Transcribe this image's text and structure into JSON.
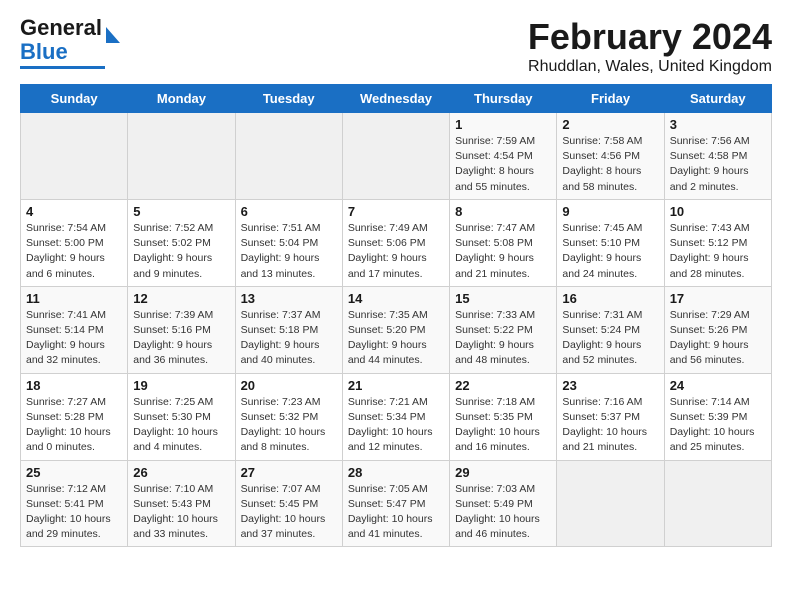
{
  "header": {
    "logo_general": "General",
    "logo_blue": "Blue",
    "main_title": "February 2024",
    "subtitle": "Rhuddlan, Wales, United Kingdom"
  },
  "weekdays": [
    "Sunday",
    "Monday",
    "Tuesday",
    "Wednesday",
    "Thursday",
    "Friday",
    "Saturday"
  ],
  "weeks": [
    [
      {
        "day": "",
        "info": ""
      },
      {
        "day": "",
        "info": ""
      },
      {
        "day": "",
        "info": ""
      },
      {
        "day": "",
        "info": ""
      },
      {
        "day": "1",
        "info": "Sunrise: 7:59 AM\nSunset: 4:54 PM\nDaylight: 8 hours\nand 55 minutes."
      },
      {
        "day": "2",
        "info": "Sunrise: 7:58 AM\nSunset: 4:56 PM\nDaylight: 8 hours\nand 58 minutes."
      },
      {
        "day": "3",
        "info": "Sunrise: 7:56 AM\nSunset: 4:58 PM\nDaylight: 9 hours\nand 2 minutes."
      }
    ],
    [
      {
        "day": "4",
        "info": "Sunrise: 7:54 AM\nSunset: 5:00 PM\nDaylight: 9 hours\nand 6 minutes."
      },
      {
        "day": "5",
        "info": "Sunrise: 7:52 AM\nSunset: 5:02 PM\nDaylight: 9 hours\nand 9 minutes."
      },
      {
        "day": "6",
        "info": "Sunrise: 7:51 AM\nSunset: 5:04 PM\nDaylight: 9 hours\nand 13 minutes."
      },
      {
        "day": "7",
        "info": "Sunrise: 7:49 AM\nSunset: 5:06 PM\nDaylight: 9 hours\nand 17 minutes."
      },
      {
        "day": "8",
        "info": "Sunrise: 7:47 AM\nSunset: 5:08 PM\nDaylight: 9 hours\nand 21 minutes."
      },
      {
        "day": "9",
        "info": "Sunrise: 7:45 AM\nSunset: 5:10 PM\nDaylight: 9 hours\nand 24 minutes."
      },
      {
        "day": "10",
        "info": "Sunrise: 7:43 AM\nSunset: 5:12 PM\nDaylight: 9 hours\nand 28 minutes."
      }
    ],
    [
      {
        "day": "11",
        "info": "Sunrise: 7:41 AM\nSunset: 5:14 PM\nDaylight: 9 hours\nand 32 minutes."
      },
      {
        "day": "12",
        "info": "Sunrise: 7:39 AM\nSunset: 5:16 PM\nDaylight: 9 hours\nand 36 minutes."
      },
      {
        "day": "13",
        "info": "Sunrise: 7:37 AM\nSunset: 5:18 PM\nDaylight: 9 hours\nand 40 minutes."
      },
      {
        "day": "14",
        "info": "Sunrise: 7:35 AM\nSunset: 5:20 PM\nDaylight: 9 hours\nand 44 minutes."
      },
      {
        "day": "15",
        "info": "Sunrise: 7:33 AM\nSunset: 5:22 PM\nDaylight: 9 hours\nand 48 minutes."
      },
      {
        "day": "16",
        "info": "Sunrise: 7:31 AM\nSunset: 5:24 PM\nDaylight: 9 hours\nand 52 minutes."
      },
      {
        "day": "17",
        "info": "Sunrise: 7:29 AM\nSunset: 5:26 PM\nDaylight: 9 hours\nand 56 minutes."
      }
    ],
    [
      {
        "day": "18",
        "info": "Sunrise: 7:27 AM\nSunset: 5:28 PM\nDaylight: 10 hours\nand 0 minutes."
      },
      {
        "day": "19",
        "info": "Sunrise: 7:25 AM\nSunset: 5:30 PM\nDaylight: 10 hours\nand 4 minutes."
      },
      {
        "day": "20",
        "info": "Sunrise: 7:23 AM\nSunset: 5:32 PM\nDaylight: 10 hours\nand 8 minutes."
      },
      {
        "day": "21",
        "info": "Sunrise: 7:21 AM\nSunset: 5:34 PM\nDaylight: 10 hours\nand 12 minutes."
      },
      {
        "day": "22",
        "info": "Sunrise: 7:18 AM\nSunset: 5:35 PM\nDaylight: 10 hours\nand 16 minutes."
      },
      {
        "day": "23",
        "info": "Sunrise: 7:16 AM\nSunset: 5:37 PM\nDaylight: 10 hours\nand 21 minutes."
      },
      {
        "day": "24",
        "info": "Sunrise: 7:14 AM\nSunset: 5:39 PM\nDaylight: 10 hours\nand 25 minutes."
      }
    ],
    [
      {
        "day": "25",
        "info": "Sunrise: 7:12 AM\nSunset: 5:41 PM\nDaylight: 10 hours\nand 29 minutes."
      },
      {
        "day": "26",
        "info": "Sunrise: 7:10 AM\nSunset: 5:43 PM\nDaylight: 10 hours\nand 33 minutes."
      },
      {
        "day": "27",
        "info": "Sunrise: 7:07 AM\nSunset: 5:45 PM\nDaylight: 10 hours\nand 37 minutes."
      },
      {
        "day": "28",
        "info": "Sunrise: 7:05 AM\nSunset: 5:47 PM\nDaylight: 10 hours\nand 41 minutes."
      },
      {
        "day": "29",
        "info": "Sunrise: 7:03 AM\nSunset: 5:49 PM\nDaylight: 10 hours\nand 46 minutes."
      },
      {
        "day": "",
        "info": ""
      },
      {
        "day": "",
        "info": ""
      }
    ]
  ]
}
